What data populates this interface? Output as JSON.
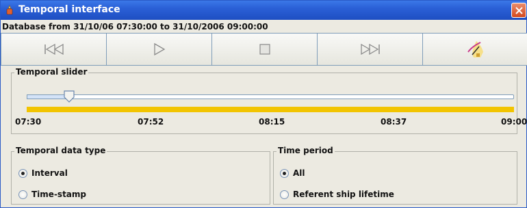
{
  "window": {
    "title": "Temporal interface"
  },
  "database_range": "Database from 31/10/06 07:30:00 to 31/10/2006 09:00:00",
  "toolbar": {
    "buttons": [
      {
        "icon": "skip-to-start-icon"
      },
      {
        "icon": "play-icon"
      },
      {
        "icon": "stop-icon"
      },
      {
        "icon": "skip-to-end-icon"
      },
      {
        "icon": "trajectory-map-icon"
      }
    ]
  },
  "temporal_slider": {
    "label": "Temporal slider",
    "value_fraction": 0.09,
    "ticks": [
      "07:30",
      "07:52",
      "08:15",
      "08:37",
      "09:00"
    ]
  },
  "temporal_data_type": {
    "label": "Temporal data type",
    "options": [
      {
        "label": "Interval",
        "selected": true
      },
      {
        "label": "Time-stamp",
        "selected": false
      }
    ]
  },
  "time_period": {
    "label": "Time period",
    "options": [
      {
        "label": "All",
        "selected": true
      },
      {
        "label": "Referent ship lifetime",
        "selected": false
      }
    ]
  },
  "colors": {
    "title_bar": "#2a5fd6",
    "slider_timeline": "#f2c400",
    "close_button": "#d44a1f"
  }
}
